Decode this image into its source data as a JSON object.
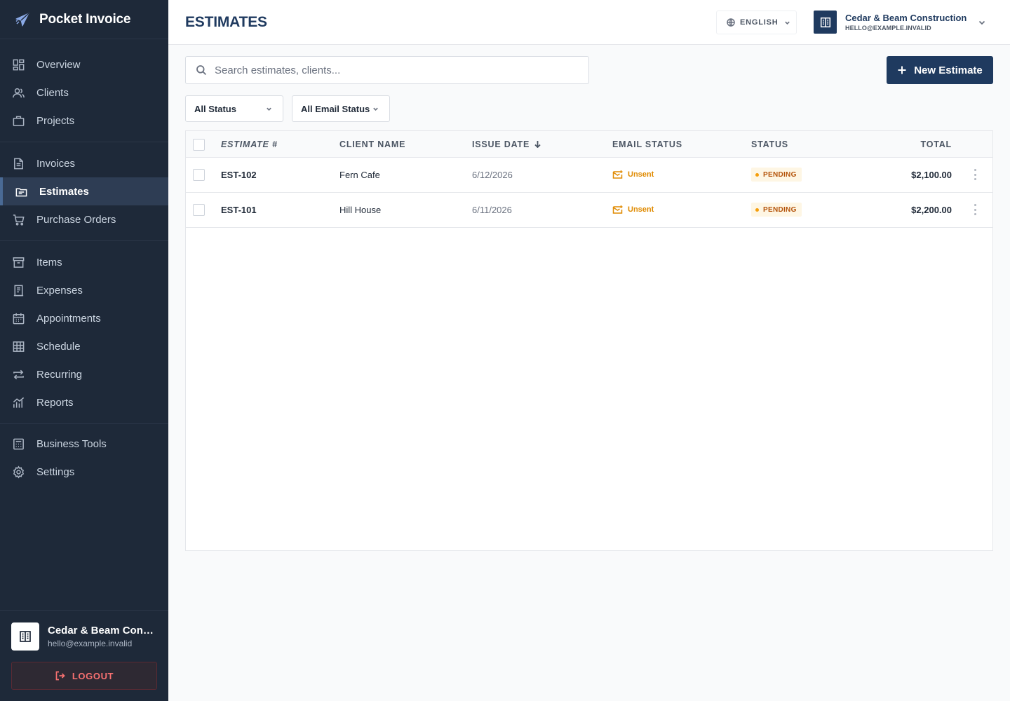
{
  "brand": {
    "name": "Pocket Invoice"
  },
  "sidebar": {
    "groups": [
      {
        "items": [
          {
            "label": "Overview",
            "icon": "overview-icon"
          },
          {
            "label": "Clients",
            "icon": "clients-icon"
          },
          {
            "label": "Projects",
            "icon": "projects-icon"
          }
        ]
      },
      {
        "items": [
          {
            "label": "Invoices",
            "icon": "invoices-icon"
          },
          {
            "label": "Estimates",
            "icon": "estimates-icon",
            "active": true
          },
          {
            "label": "Purchase Orders",
            "icon": "cart-icon"
          }
        ]
      },
      {
        "items": [
          {
            "label": "Items",
            "icon": "archive-icon"
          },
          {
            "label": "Expenses",
            "icon": "receipt-icon"
          },
          {
            "label": "Appointments",
            "icon": "calendar-icon"
          },
          {
            "label": "Schedule",
            "icon": "grid-icon"
          },
          {
            "label": "Recurring",
            "icon": "repeat-icon"
          },
          {
            "label": "Reports",
            "icon": "chart-icon"
          }
        ]
      },
      {
        "items": [
          {
            "label": "Business Tools",
            "icon": "calculator-icon"
          },
          {
            "label": "Settings",
            "icon": "gear-icon"
          }
        ]
      }
    ],
    "account": {
      "name": "Cedar & Beam Const...",
      "email": "hello@example.invalid"
    },
    "logout_label": "LOGOUT"
  },
  "header": {
    "title": "ESTIMATES",
    "language": "ENGLISH",
    "company_name": "Cedar & Beam Construction",
    "company_email": "HELLO@EXAMPLE.INVALID"
  },
  "search": {
    "placeholder": "Search estimates, clients...",
    "value": ""
  },
  "new_button_label": "New Estimate",
  "filters": {
    "status": "All Status",
    "email_status": "All Email Status"
  },
  "table": {
    "columns": {
      "number": "ESTIMATE #",
      "client": "CLIENT NAME",
      "issue_date": "ISSUE DATE",
      "email_status": "EMAIL STATUS",
      "status": "STATUS",
      "total": "TOTAL"
    },
    "rows": [
      {
        "number": "EST-102",
        "client": "Fern Cafe",
        "issue_date": "6/12/2026",
        "email_status": "Unsent",
        "status": "PENDING",
        "total": "$2,100.00"
      },
      {
        "number": "EST-101",
        "client": "Hill House",
        "issue_date": "6/11/2026",
        "email_status": "Unsent",
        "status": "PENDING",
        "total": "$2,200.00"
      }
    ]
  },
  "colors": {
    "sidebar": "#1e2939",
    "accent": "#1f3a5f",
    "pending": "#b45309",
    "unsent": "#e08a00",
    "logout": "#f87171"
  }
}
